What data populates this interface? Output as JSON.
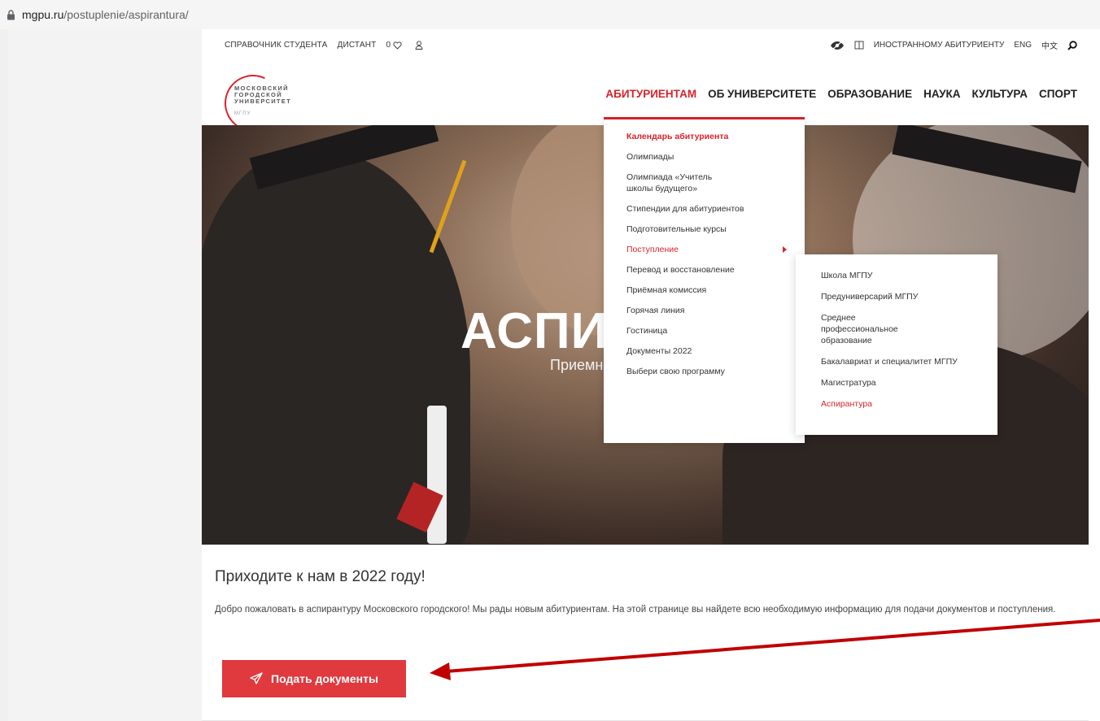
{
  "browser": {
    "url_host": "mgpu.ru",
    "url_path": "/postuplenie/aspirantura/"
  },
  "topbar": {
    "left": [
      "СПРАВОЧНИК СТУДЕНТА",
      "ДИСТАНТ"
    ],
    "favorites_count": "0",
    "right_link": "ИНОСТРАННОМУ АБИТУРИЕНТУ",
    "lang_en": "ENG",
    "lang_cn": "中文"
  },
  "logo": {
    "line1": "МОСКОВСКИЙ",
    "line2": "ГОРОДСКОЙ",
    "line3": "УНИВЕРСИТЕТ",
    "short": "МГПУ"
  },
  "nav": [
    "АБИТУРИЕНТАМ",
    "ОБ УНИВЕРСИТЕТЕ",
    "ОБРАЗОВАНИЕ",
    "НАУКА",
    "КУЛЬТУРА",
    "СПОРТ"
  ],
  "hero": {
    "title": "АСПИ",
    "subtitle": "Приемн"
  },
  "dropdown": [
    "Календарь абитуриента",
    "Олимпиады",
    "Олимпиада «Учитель школы будущего»",
    "Стипендии для абитуриентов",
    "Подготовительные курсы",
    "Поступление",
    "Перевод и восстановление",
    "Приёмная комиссия",
    "Горячая линия",
    "Гостиница",
    "Документы 2022",
    "Выбери свою программу"
  ],
  "submenu": [
    "Школа МГПУ",
    "Предуниверсарий МГПУ",
    "Среднее профессиональное образование",
    "Бакалавриат и специалитет МГПУ",
    "Магистратура",
    "Аспирантура"
  ],
  "content": {
    "heading": "Приходите к нам в 2022 году!",
    "paragraph": "Добро пожаловать в аспирантуру Московского городского! Мы рады новым абитуриентам. На этой странице вы найдете всю необходимую информацию для подачи документов и поступления.",
    "cta": "Подать документы"
  },
  "colors": {
    "accent": "#d8232a",
    "cta": "#e0393e",
    "annotation_arrow": "#c00000"
  }
}
